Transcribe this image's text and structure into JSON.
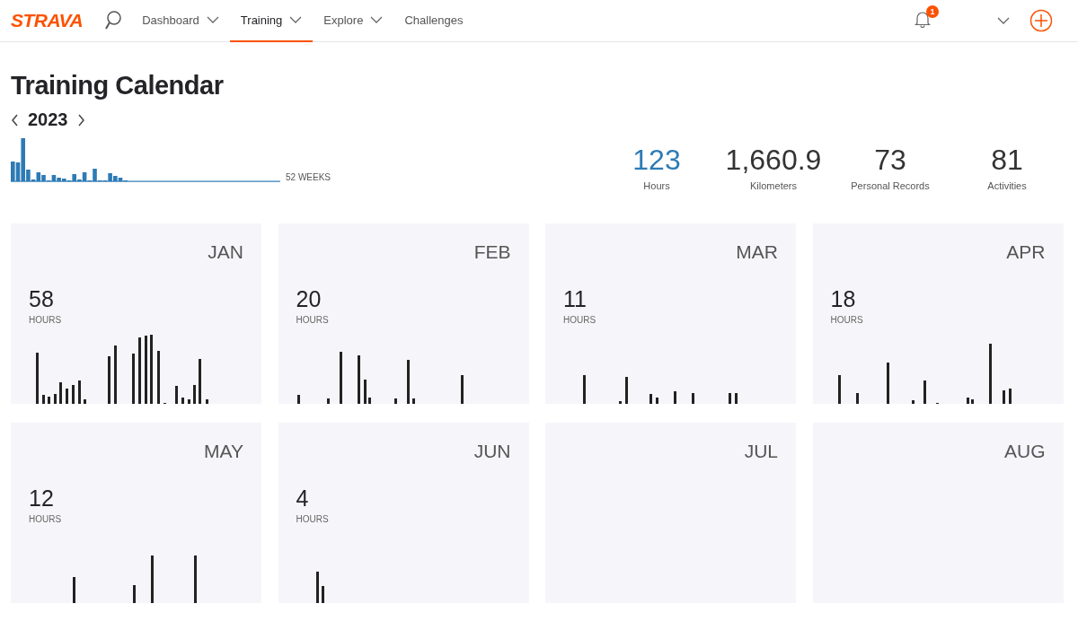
{
  "header": {
    "logo": "STRAVA",
    "nav": [
      {
        "label": "Dashboard",
        "selected": false,
        "dropdown": true
      },
      {
        "label": "Training",
        "selected": true,
        "dropdown": true
      },
      {
        "label": "Explore",
        "selected": false,
        "dropdown": true
      },
      {
        "label": "Challenges",
        "selected": false,
        "dropdown": false
      }
    ],
    "notification_count": "1"
  },
  "title": "Training Calendar",
  "year": "2023",
  "weeks_label": "52 WEEKS",
  "stats": [
    {
      "value": "123",
      "label": "Hours",
      "selected": true
    },
    {
      "value": "1,660.9",
      "label": "Kilometers",
      "selected": false
    },
    {
      "value": "73",
      "label": "Personal Records",
      "selected": false
    },
    {
      "value": "81",
      "label": "Activities",
      "selected": false
    }
  ],
  "months": [
    {
      "month": "JAN",
      "value": "58",
      "unit": "HOURS"
    },
    {
      "month": "FEB",
      "value": "20",
      "unit": "HOURS"
    },
    {
      "month": "MAR",
      "value": "11",
      "unit": "HOURS"
    },
    {
      "month": "APR",
      "value": "18",
      "unit": "HOURS"
    },
    {
      "month": "MAY",
      "value": "12",
      "unit": "HOURS"
    },
    {
      "month": "JUN",
      "value": "4",
      "unit": "HOURS"
    },
    {
      "month": "JUL"
    },
    {
      "month": "AUG"
    }
  ]
}
